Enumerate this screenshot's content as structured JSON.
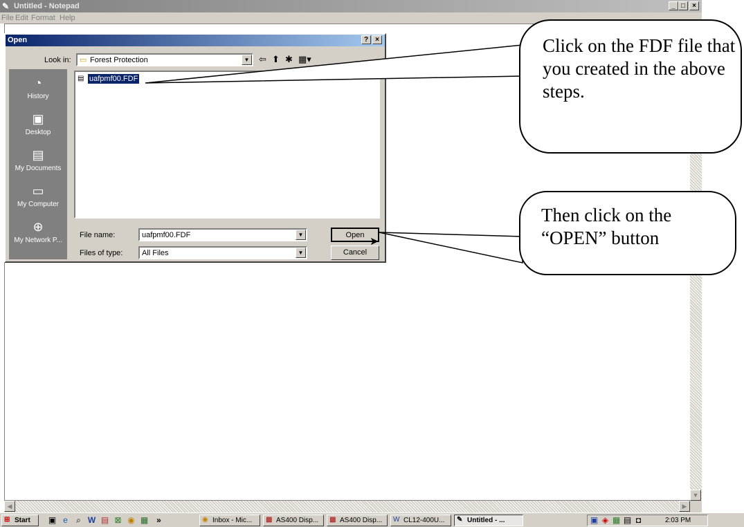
{
  "notepad": {
    "title": "Untitled - Notepad",
    "menu": [
      "File",
      "Edit",
      "Format",
      "Help"
    ],
    "window_buttons": [
      "_",
      "□",
      "×"
    ]
  },
  "dialog": {
    "title": "Open",
    "help_button": "?",
    "close_button": "×",
    "look_in_label": "Look in:",
    "look_in_value": "Forest Protection",
    "places": [
      "History",
      "Desktop",
      "My Documents",
      "My Computer",
      "My Network P..."
    ],
    "selected_file": "uafpmf00.FDF",
    "file_name_label": "File name:",
    "file_name_value": "uafpmf00.FDF",
    "files_of_type_label": "Files of type:",
    "files_of_type_value": "All Files",
    "open_button": "Open",
    "cancel_button": "Cancel"
  },
  "callouts": {
    "top_text": "Click on the FDF file that you created in the above steps.",
    "bottom_text": "Then click on the “OPEN” button"
  },
  "taskbar": {
    "start": "Start",
    "chevron": "»",
    "tasks": [
      "Inbox - Mic...",
      "AS400 Disp...",
      "AS400 Disp...",
      "CL12-400U...",
      "Untitled - ..."
    ],
    "clock": "2:03 PM"
  },
  "colors": {
    "dialog_title": "#0a246a",
    "face": "#d4d0c8",
    "places_bar": "#808080"
  }
}
